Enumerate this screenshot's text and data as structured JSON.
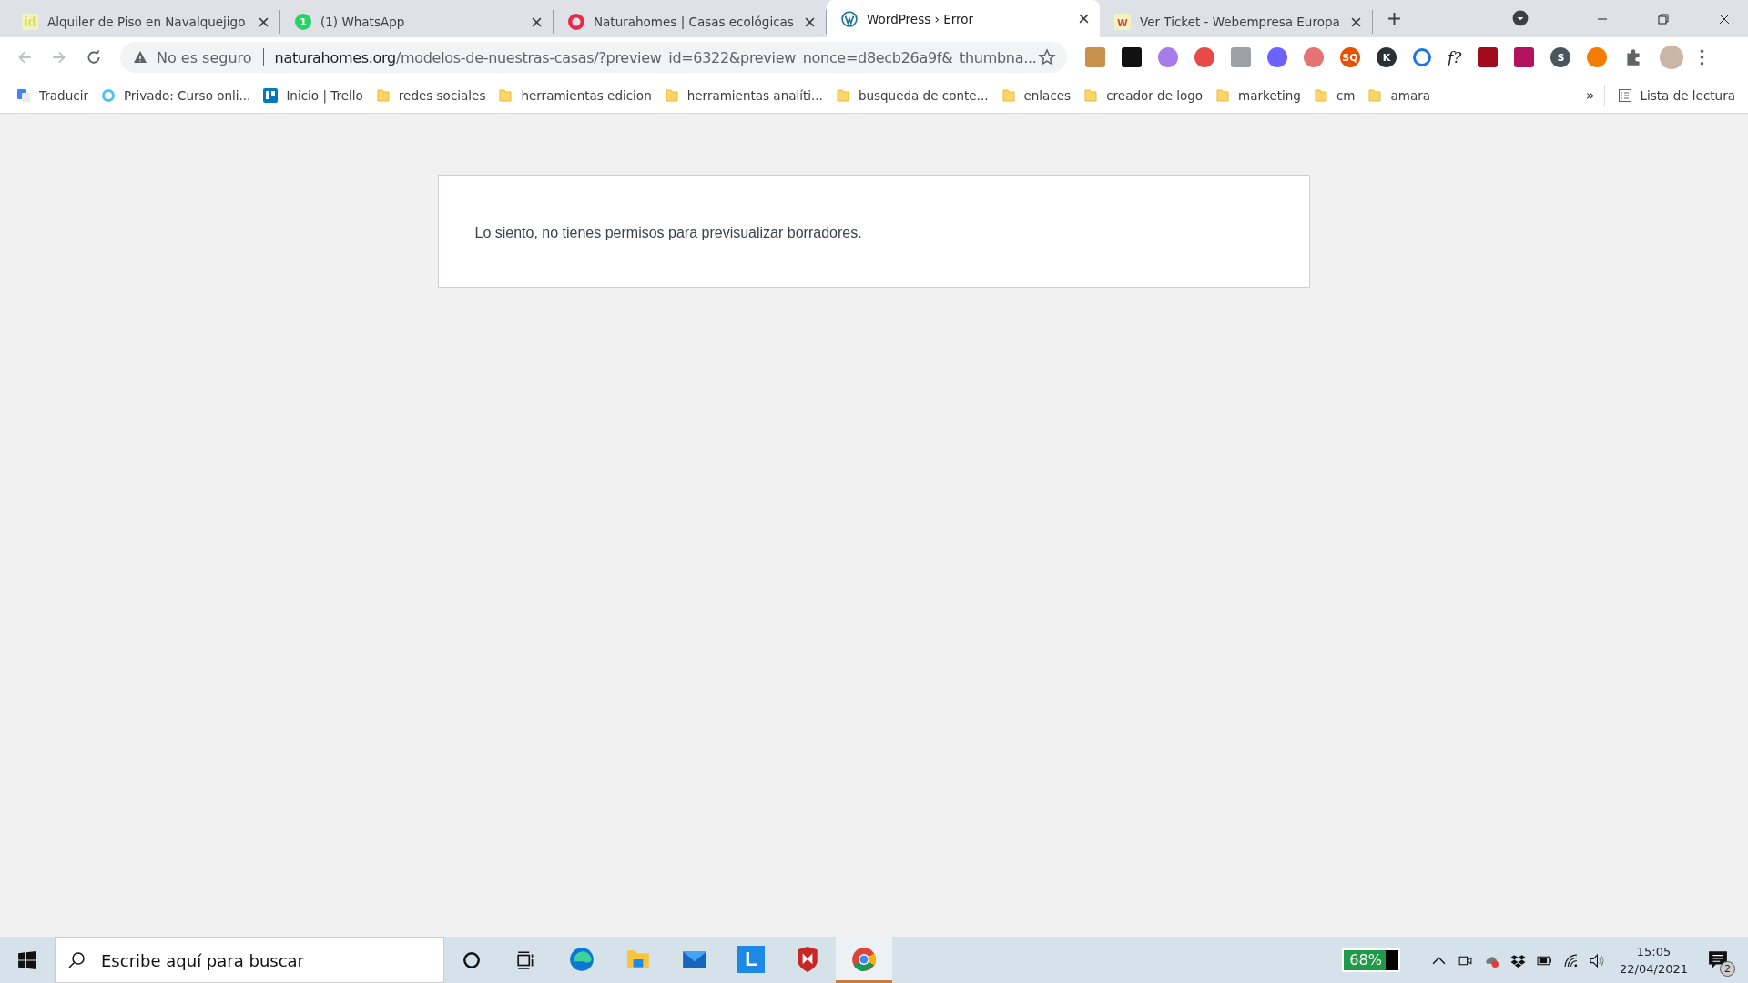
{
  "tabs": [
    {
      "title": "Alquiler de Piso en Navalquejigo",
      "selected": false,
      "kind": "text",
      "glyph": "id",
      "color": "#d4e157"
    },
    {
      "title": "(1) WhatsApp",
      "selected": false,
      "kind": "badge",
      "glyph": "1",
      "color": "#25d366"
    },
    {
      "title": "Naturahomes | Casas ecológicas",
      "selected": false,
      "kind": "ring",
      "color": "#e8294a"
    },
    {
      "title": "WordPress › Error",
      "selected": true,
      "kind": "wp",
      "color": "#21759b"
    },
    {
      "title": "Ver Ticket - Webempresa Europa",
      "selected": false,
      "kind": "text",
      "glyph": "w",
      "color": "#e53935"
    }
  ],
  "toolbar": {
    "security": "No es seguro",
    "url_host": "naturahomes.org",
    "url_path": "/modelos-de-nuestras-casas/?preview_id=6322&preview_nonce=d8ecb26a9f&_thumbna..."
  },
  "extensions": [
    {
      "kind": "square",
      "color": "#c8904a"
    },
    {
      "kind": "square",
      "color": "#111111"
    },
    {
      "kind": "circle",
      "color": "#a77be8"
    },
    {
      "kind": "circle",
      "color": "#e84a4a"
    },
    {
      "kind": "square",
      "color": "#9aa0a6"
    },
    {
      "kind": "circle",
      "color": "#6c63ff"
    },
    {
      "kind": "circle",
      "color": "#e57373"
    },
    {
      "kind": "glyph",
      "glyph": "SQ",
      "color": "#e65100"
    },
    {
      "kind": "glyph",
      "glyph": "K",
      "color": "#263238"
    },
    {
      "kind": "ring",
      "color": "#1a73e8"
    },
    {
      "kind": "plain",
      "glyph": "f?",
      "color": "#202124"
    },
    {
      "kind": "square",
      "color": "#a00b1d"
    },
    {
      "kind": "square",
      "color": "#b3125e"
    },
    {
      "kind": "glyph",
      "glyph": "S",
      "color": "#4a5560"
    },
    {
      "kind": "circle",
      "color": "#f57c00"
    }
  ],
  "bookmarks": [
    {
      "label": "Traducir",
      "kind": "translate"
    },
    {
      "label": "Privado: Curso onli...",
      "kind": "site"
    },
    {
      "label": "Inicio | Trello",
      "kind": "trello"
    },
    {
      "label": "redes sociales",
      "kind": "folder"
    },
    {
      "label": "herramientas edicion",
      "kind": "folder"
    },
    {
      "label": "herramientas analíti...",
      "kind": "folder"
    },
    {
      "label": "busqueda de conte...",
      "kind": "folder"
    },
    {
      "label": "enlaces",
      "kind": "folder"
    },
    {
      "label": "creador de logo",
      "kind": "folder"
    },
    {
      "label": "marketing",
      "kind": "folder"
    },
    {
      "label": "cm",
      "kind": "folder"
    },
    {
      "label": "amara",
      "kind": "folder"
    }
  ],
  "more_bookmarks": "»",
  "reading_list": "Lista de lectura",
  "message": "Lo siento, no tienes permisos para previsualizar borradores.",
  "taskbar": {
    "search_placeholder": "Escribe aquí para buscar",
    "apps": [
      {
        "kind": "edge",
        "selected": false
      },
      {
        "kind": "folder",
        "selected": false
      },
      {
        "kind": "mail",
        "selected": false
      },
      {
        "kind": "letter",
        "glyph": "L",
        "selected": false
      },
      {
        "kind": "shield",
        "selected": false
      },
      {
        "kind": "chrome",
        "selected": true
      }
    ],
    "battery_label": "68%",
    "battery": {
      "level": 0.68
    },
    "time": "15:05",
    "date": "22/04/2021",
    "notifications": "2"
  }
}
